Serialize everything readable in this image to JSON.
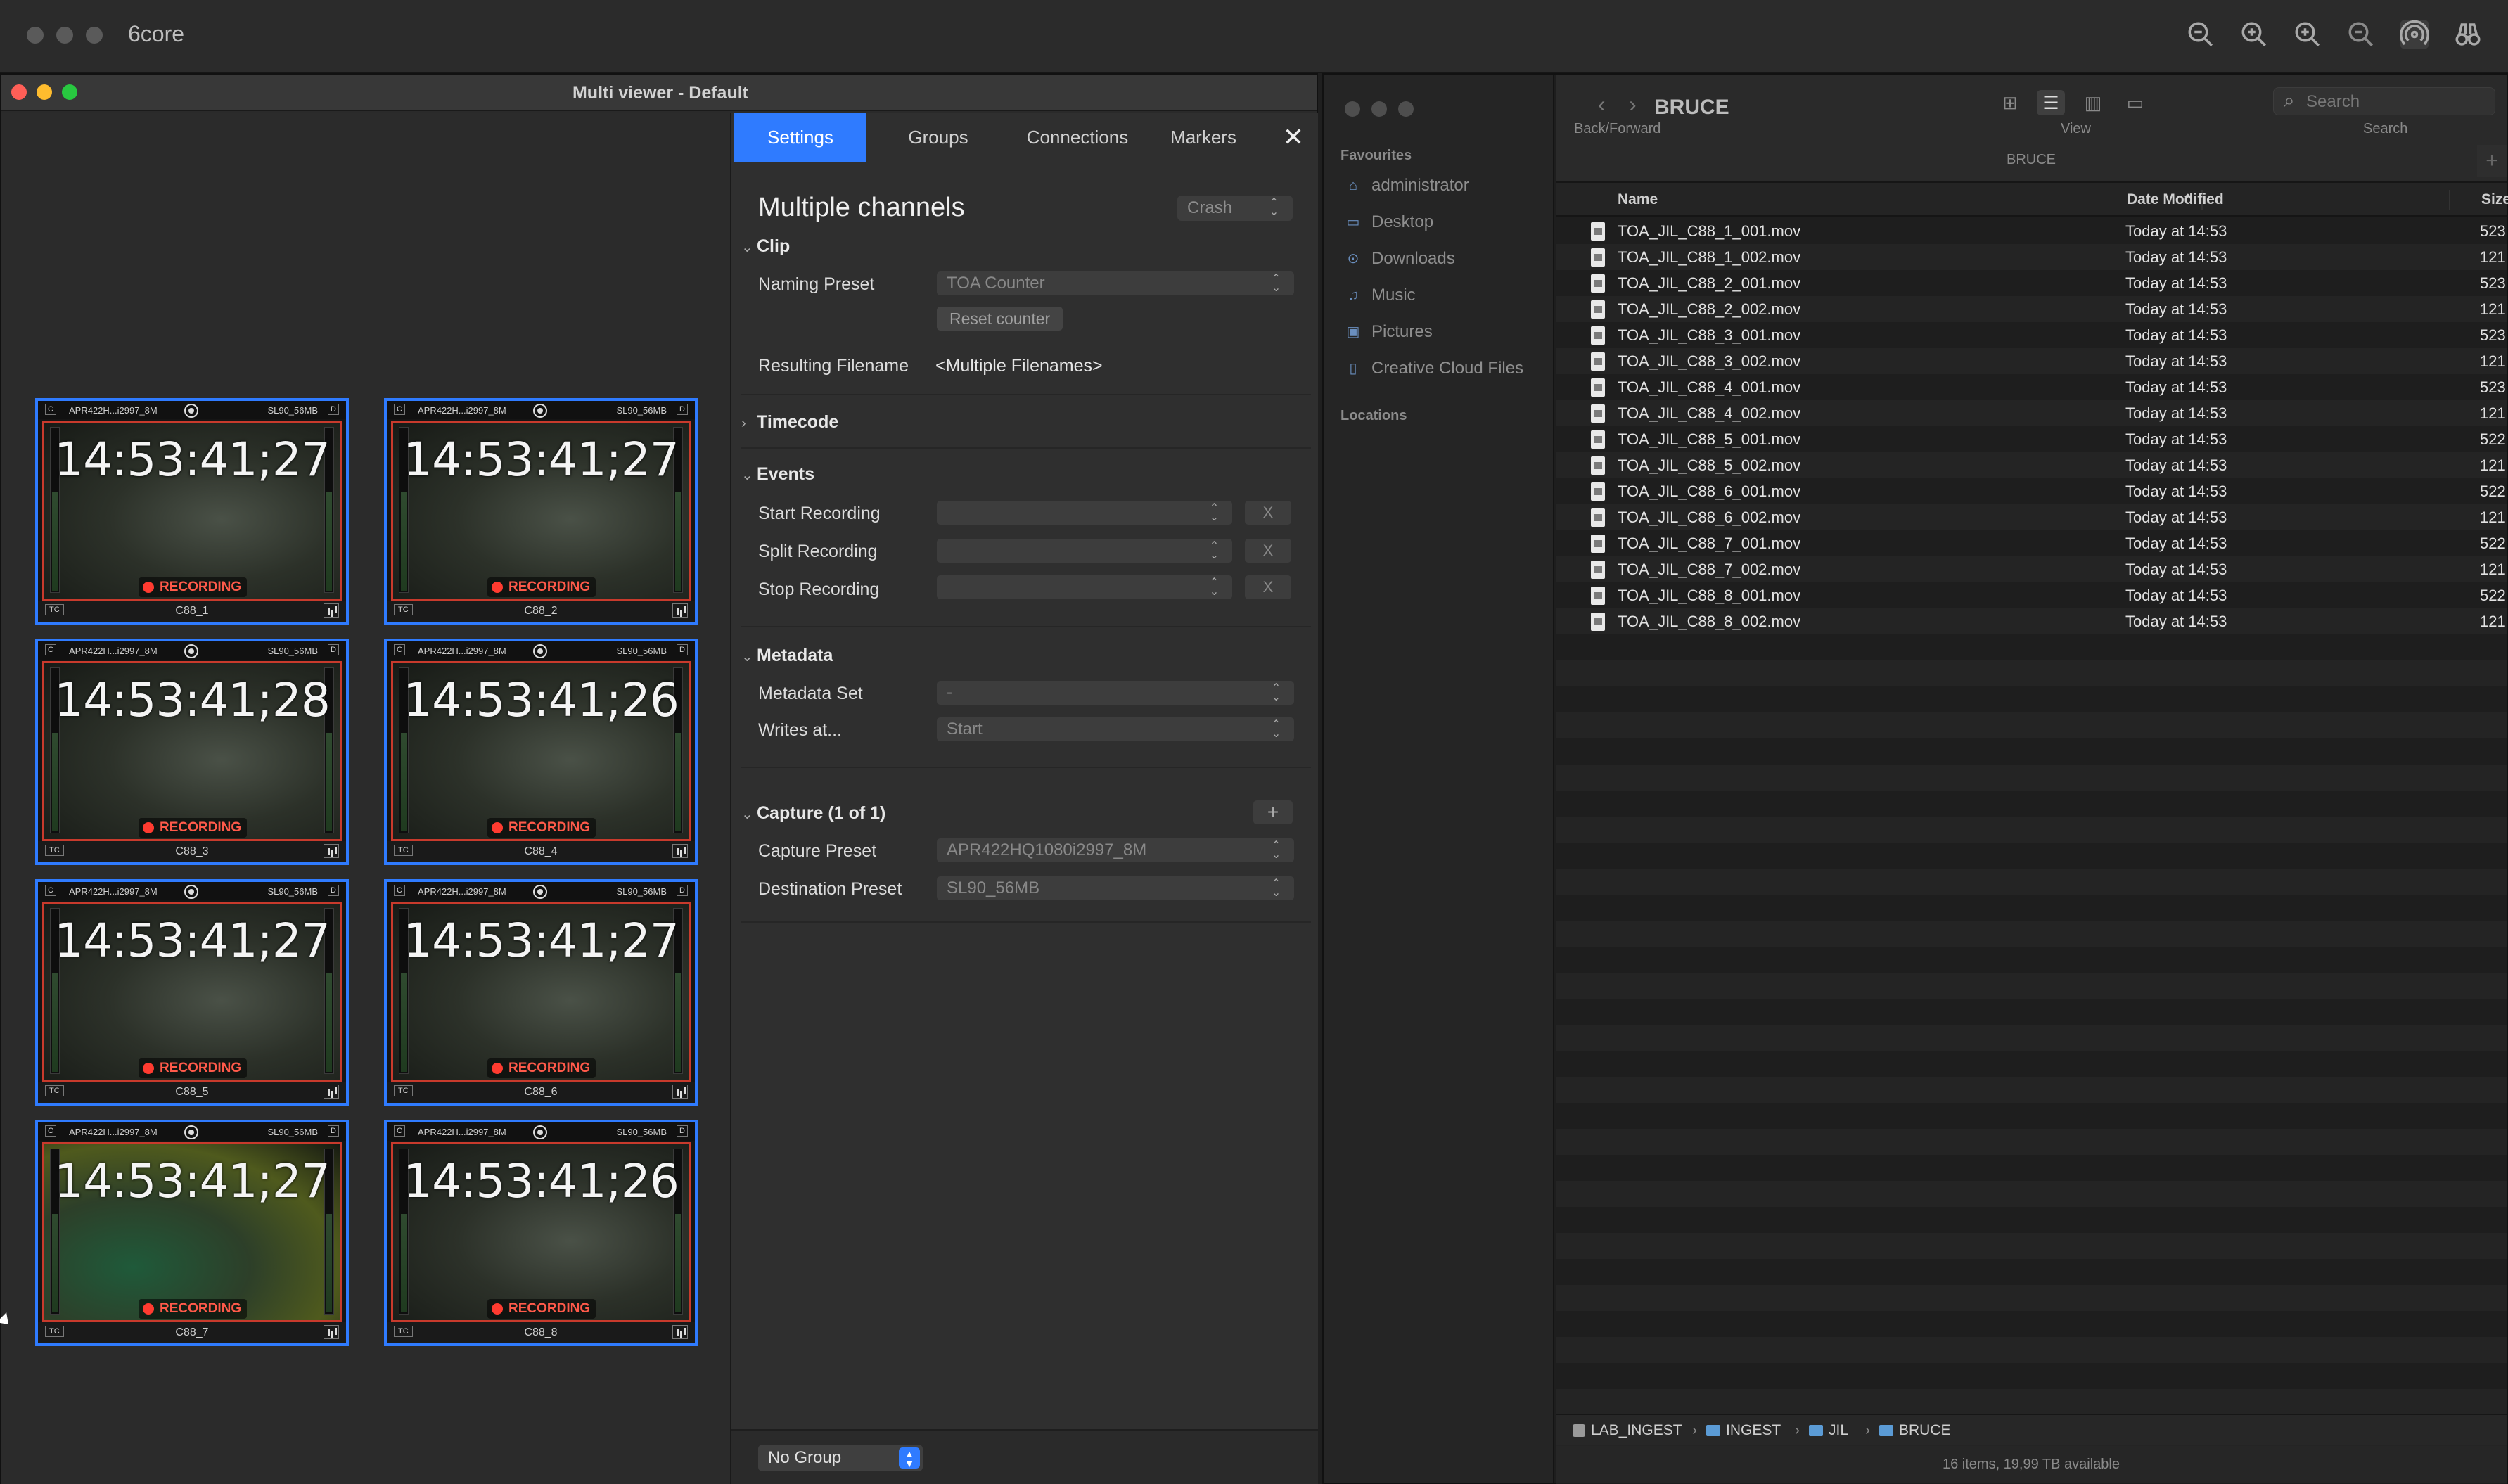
{
  "app": {
    "title": "6core"
  },
  "multiviewer": {
    "window_title": "Multi viewer - Default",
    "tiles": [
      {
        "format": "APR422H...i2997_8M",
        "dest": "SL90_56MB",
        "timecode": "14:53:41;27",
        "status": "RECORDING",
        "tc_label": "TC",
        "name": "C88_1",
        "c": "C",
        "d": "D"
      },
      {
        "format": "APR422H...i2997_8M",
        "dest": "SL90_56MB",
        "timecode": "14:53:41;27",
        "status": "RECORDING",
        "tc_label": "TC",
        "name": "C88_2",
        "c": "C",
        "d": "D"
      },
      {
        "format": "APR422H...i2997_8M",
        "dest": "SL90_56MB",
        "timecode": "14:53:41;28",
        "status": "RECORDING",
        "tc_label": "TC",
        "name": "C88_3",
        "c": "C",
        "d": "D"
      },
      {
        "format": "APR422H...i2997_8M",
        "dest": "SL90_56MB",
        "timecode": "14:53:41;26",
        "status": "RECORDING",
        "tc_label": "TC",
        "name": "C88_4",
        "c": "C",
        "d": "D"
      },
      {
        "format": "APR422H...i2997_8M",
        "dest": "SL90_56MB",
        "timecode": "14:53:41;27",
        "status": "RECORDING",
        "tc_label": "TC",
        "name": "C88_5",
        "c": "C",
        "d": "D"
      },
      {
        "format": "APR422H...i2997_8M",
        "dest": "SL90_56MB",
        "timecode": "14:53:41;27",
        "status": "RECORDING",
        "tc_label": "TC",
        "name": "C88_6",
        "c": "C",
        "d": "D"
      },
      {
        "format": "APR422H...i2997_8M",
        "dest": "SL90_56MB",
        "timecode": "14:53:41;27",
        "status": "RECORDING",
        "tc_label": "TC",
        "name": "C88_7",
        "c": "C",
        "d": "D"
      },
      {
        "format": "APR422H...i2997_8M",
        "dest": "SL90_56MB",
        "timecode": "14:53:41;26",
        "status": "RECORDING",
        "tc_label": "TC",
        "name": "C88_8",
        "c": "C",
        "d": "D"
      }
    ]
  },
  "settings": {
    "tabs": [
      "Settings",
      "Groups",
      "Connections",
      "Markers"
    ],
    "close": "✕",
    "heading": "Multiple channels",
    "crash_label": "Crash",
    "clip": {
      "title": "Clip",
      "naming_preset_label": "Naming Preset",
      "naming_preset_value": "TOA Counter",
      "reset_counter": "Reset counter",
      "resulting_filename_label": "Resulting Filename",
      "resulting_filename_value": "<Multiple Filenames>"
    },
    "timecode": {
      "title": "Timecode"
    },
    "events": {
      "title": "Events",
      "start_recording": "Start Recording",
      "split_recording": "Split Recording",
      "stop_recording": "Stop Recording",
      "clear": "X"
    },
    "metadata": {
      "title": "Metadata",
      "metadata_set_label": "Metadata Set",
      "metadata_set_value": "-",
      "writes_at_label": "Writes at...",
      "writes_at_value": "Start"
    },
    "capture": {
      "title": "Capture (1 of 1)",
      "add": "+",
      "capture_preset_label": "Capture Preset",
      "capture_preset_value": "APR422HQ1080i2997_8M",
      "destination_preset_label": "Destination Preset",
      "destination_preset_value": "SL90_56MB"
    },
    "group_select": "No Group"
  },
  "finder": {
    "title": "BRUCE",
    "back_forward": "Back/Forward",
    "view_label": "View",
    "search_label": "Search",
    "search_placeholder": "Search",
    "path_title": "BRUCE",
    "sidebar": {
      "favourites_label": "Favourites",
      "items": [
        "administrator",
        "Desktop",
        "Downloads",
        "Music",
        "Pictures",
        "Creative Cloud Files"
      ],
      "locations_label": "Locations"
    },
    "columns": {
      "name": "Name",
      "date": "Date Modified",
      "size": "Size"
    },
    "files": [
      {
        "name": "TOA_JIL_C88_1_001.mov",
        "date": "Today at 14:53",
        "size": "523"
      },
      {
        "name": "TOA_JIL_C88_1_002.mov",
        "date": "Today at 14:53",
        "size": "121"
      },
      {
        "name": "TOA_JIL_C88_2_001.mov",
        "date": "Today at 14:53",
        "size": "523"
      },
      {
        "name": "TOA_JIL_C88_2_002.mov",
        "date": "Today at 14:53",
        "size": "121"
      },
      {
        "name": "TOA_JIL_C88_3_001.mov",
        "date": "Today at 14:53",
        "size": "523"
      },
      {
        "name": "TOA_JIL_C88_3_002.mov",
        "date": "Today at 14:53",
        "size": "121"
      },
      {
        "name": "TOA_JIL_C88_4_001.mov",
        "date": "Today at 14:53",
        "size": "523"
      },
      {
        "name": "TOA_JIL_C88_4_002.mov",
        "date": "Today at 14:53",
        "size": "121"
      },
      {
        "name": "TOA_JIL_C88_5_001.mov",
        "date": "Today at 14:53",
        "size": "522"
      },
      {
        "name": "TOA_JIL_C88_5_002.mov",
        "date": "Today at 14:53",
        "size": "121"
      },
      {
        "name": "TOA_JIL_C88_6_001.mov",
        "date": "Today at 14:53",
        "size": "522"
      },
      {
        "name": "TOA_JIL_C88_6_002.mov",
        "date": "Today at 14:53",
        "size": "121"
      },
      {
        "name": "TOA_JIL_C88_7_001.mov",
        "date": "Today at 14:53",
        "size": "522"
      },
      {
        "name": "TOA_JIL_C88_7_002.mov",
        "date": "Today at 14:53",
        "size": "121"
      },
      {
        "name": "TOA_JIL_C88_8_001.mov",
        "date": "Today at 14:53",
        "size": "522"
      },
      {
        "name": "TOA_JIL_C88_8_002.mov",
        "date": "Today at 14:53",
        "size": "121"
      }
    ],
    "path": [
      "LAB_INGEST",
      "INGEST",
      "JIL",
      "BRUCE"
    ],
    "path_sep": "›",
    "status": "16 items, 19,99 TB available"
  }
}
